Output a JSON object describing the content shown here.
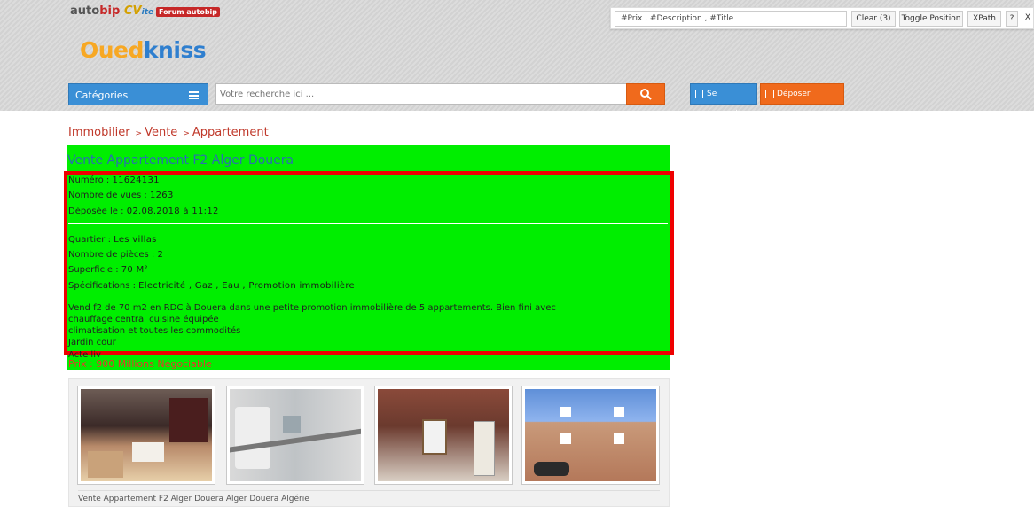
{
  "header": {
    "brands": {
      "autobip_a": "auto",
      "autobip_b": "bip",
      "cvite_a": "CV",
      "cvite_b": "ite",
      "forum": "Forum autobip"
    },
    "logo_part1": "Oued",
    "logo_part2": "kniss",
    "categories_label": "Catégories",
    "search_placeholder": "Votre recherche ici ...",
    "login_label": "Se connecter",
    "post_label": "Déposer annonce"
  },
  "xpath_tool": {
    "input_value": "#Prix , #Description , #Title",
    "clear_label": "Clear (3)",
    "toggle_label": "Toggle Position",
    "xpath_label": "XPath",
    "help_label": "?",
    "close_label": "X"
  },
  "breadcrumb": {
    "items": [
      "Immobilier",
      "Vente",
      "Appartement"
    ],
    "separator": ">"
  },
  "ad": {
    "title": "Vente Appartement F2 Alger Douera",
    "numero_label": "Numéro :",
    "numero_value": "11624131",
    "vues_label": "Nombre de vues :",
    "vues_value": "1263",
    "deposee_label": "Déposée le :",
    "deposee_value": "02.08.2018 à 11:12",
    "quartier_label": "Quartier :",
    "quartier_value": "Les villas",
    "pieces_label": "Nombre de pièces :",
    "pieces_value": "2",
    "superficie_label": "Superficie :",
    "superficie_value": "70 M²",
    "specifications_label": "Spécifications :",
    "specifications_value": "Electricité , Gaz , Eau , Promotion immobilière",
    "description_lines": [
      "Vend f2 de 70 m2 en RDC à Douera dans une petite promotion immobilière de 5 appartements. Bien fini avec",
      "chauffage central cuisine équipée",
      "climatisation et toutes les commodités",
      "Jardin cour",
      "Acte liv"
    ],
    "price": "Prix : 900 Millions Négociable"
  },
  "gallery": {
    "caption": "Vente Appartement F2 Alger Douera Alger Douera Algérie",
    "photos": [
      "kitchen-photo",
      "bathroom-photo",
      "entrance-door-photo",
      "building-facade-photo"
    ]
  },
  "colors": {
    "green_highlight": "#00ee00",
    "red_box": "#ee0000",
    "brand_blue": "#3a8fd6",
    "brand_orange": "#f06a1c",
    "breadcrumb_red": "#c0392b"
  }
}
